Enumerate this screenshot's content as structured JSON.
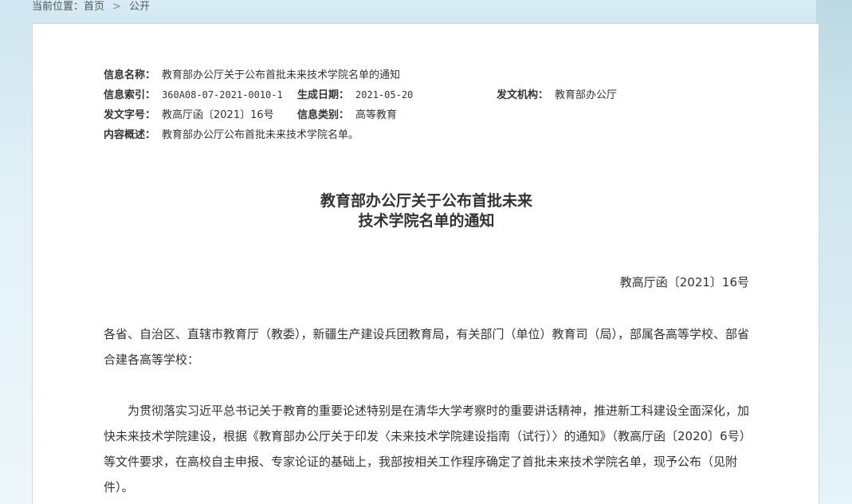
{
  "breadcrumb": {
    "label": "当前位置：",
    "home": "首页",
    "separator": ">",
    "current": "公开"
  },
  "meta": {
    "info_name_label": "信息名称：",
    "info_name_value": "教育部办公厅关于公布首批未来技术学院名单的通知",
    "index_label": "信息索引：",
    "index_value": "360A08-07-2021-0010-1",
    "date_label": "生成日期：",
    "date_value": "2021-05-20",
    "issuer_label": "发文机构：",
    "issuer_value": "教育部办公厅",
    "doc_no_label": "发文字号：",
    "doc_no_value": "教高厅函〔2021〕16号",
    "category_label": "信息类别：",
    "category_value": "高等教育",
    "summary_label": "内容概述：",
    "summary_value": "教育部办公厅公布首批未来技术学院名单。"
  },
  "document": {
    "title_line1": "教育部办公厅关于公布首批未来",
    "title_line2": "技术学院名单的通知",
    "number": "教高厅函〔2021〕16号",
    "addressees": "各省、自治区、直辖市教育厅（教委），新疆生产建设兵团教育局，有关部门（单位）教育司（局），部属各高等学校、部省合建各高等学校：",
    "paragraph1": "为贯彻落实习近平总书记关于教育的重要论述特别是在清华大学考察时的重要讲话精神，推进新工科建设全面深化，加快未来技术学院建设，根据《教育部办公厅关于印发〈未来技术学院建设指南（试行）〉的通知》（教高厅函〔2020〕6号）等文件要求，在高校自主申报、专家论证的基础上，我部按相关工作程序确定了首批未来技术学院名单，现予公布（见附件）。"
  }
}
